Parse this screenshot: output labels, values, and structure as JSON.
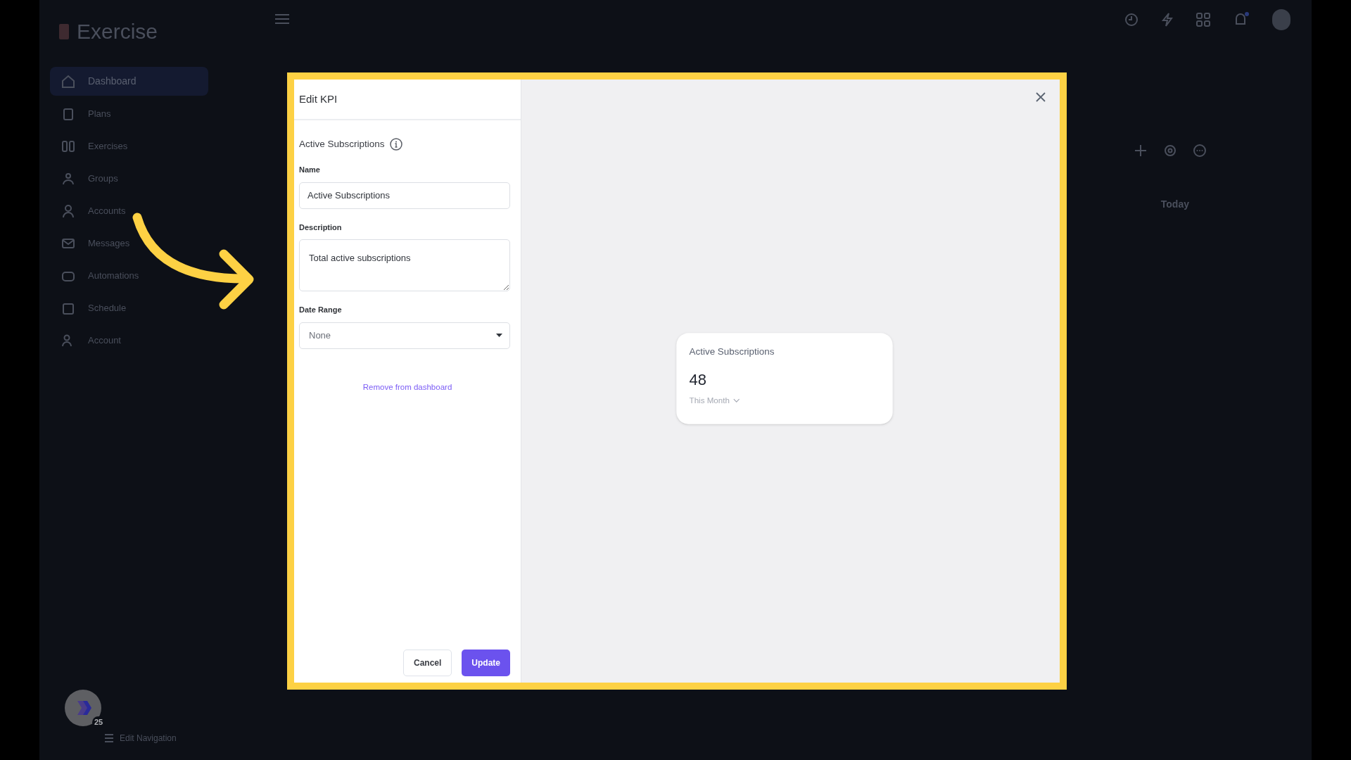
{
  "app": {
    "logo": "Exercise",
    "sidebar": {
      "items": [
        {
          "label": "Dashboard",
          "selected": true
        },
        {
          "label": "Plans",
          "selected": false
        },
        {
          "label": "Exercises",
          "selected": false
        },
        {
          "label": "Groups",
          "selected": false
        },
        {
          "label": "Accounts",
          "selected": false
        },
        {
          "label": "Messages",
          "selected": false
        },
        {
          "label": "Automations",
          "selected": false
        },
        {
          "label": "Schedule",
          "selected": false
        },
        {
          "label": "Account",
          "selected": false
        }
      ]
    },
    "footer": {
      "badge": "25",
      "link": "Edit Navigation"
    },
    "main": {
      "filter": "Today"
    }
  },
  "modal": {
    "title": "Edit KPI",
    "kpi_heading": "Active Subscriptions",
    "fields": [
      {
        "kind": "input",
        "label": "Name",
        "value": "Active Subscriptions"
      },
      {
        "kind": "textarea",
        "label": "Description",
        "value": "Total active subscriptions"
      },
      {
        "kind": "select",
        "label": "Date Range",
        "value": "None"
      }
    ],
    "remove_link": "Remove from dashboard",
    "buttons": [
      {
        "label": "Cancel",
        "kind": "secondary"
      },
      {
        "label": "Update",
        "kind": "primary"
      }
    ],
    "preview": {
      "title": "Active Subscriptions",
      "value": "48",
      "period": "This Month"
    }
  }
}
